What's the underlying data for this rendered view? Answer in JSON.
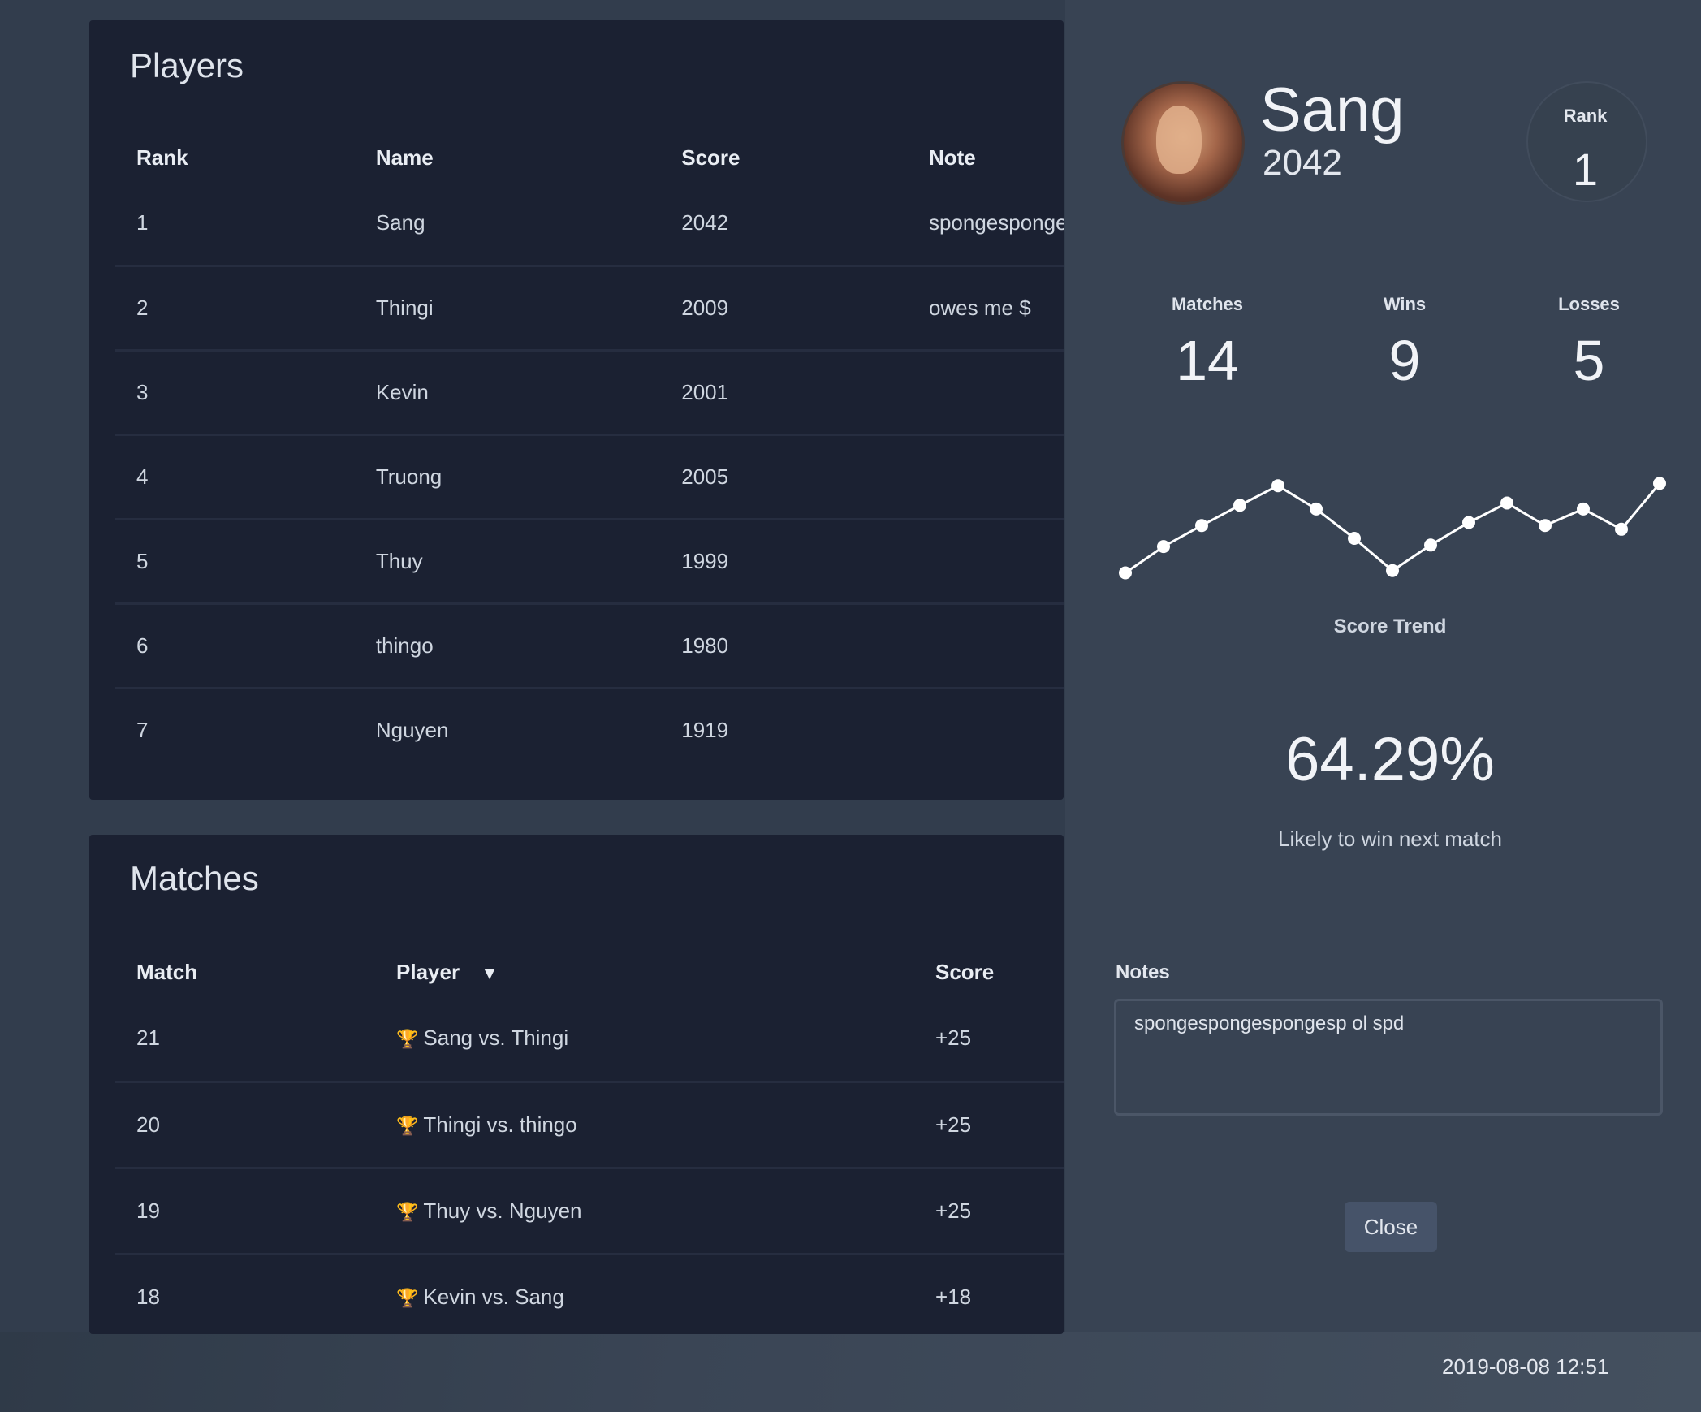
{
  "players": {
    "title": "Players",
    "columns": [
      "Rank",
      "Name",
      "Score",
      "Note"
    ],
    "rows": [
      {
        "rank": "1",
        "name": "Sang",
        "score": "2042",
        "note": "spongespongesp"
      },
      {
        "rank": "2",
        "name": "Thingi",
        "score": "2009",
        "note": "owes me $"
      },
      {
        "rank": "3",
        "name": "Kevin",
        "score": "2001",
        "note": ""
      },
      {
        "rank": "4",
        "name": "Truong",
        "score": "2005",
        "note": ""
      },
      {
        "rank": "5",
        "name": "Thuy",
        "score": "1999",
        "note": ""
      },
      {
        "rank": "6",
        "name": "thingo",
        "score": "1980",
        "note": ""
      },
      {
        "rank": "7",
        "name": "Nguyen",
        "score": "1919",
        "note": ""
      }
    ]
  },
  "matches": {
    "title": "Matches",
    "columns": [
      "Match",
      "Player",
      "Score"
    ],
    "sort_icon": "filter-triangle-icon",
    "rows": [
      {
        "match": "21",
        "players": "Sang vs. Thingi",
        "score": "+25"
      },
      {
        "match": "20",
        "players": "Thingi vs. thingo",
        "score": "+25"
      },
      {
        "match": "19",
        "players": "Thuy vs. Nguyen",
        "score": "+25"
      },
      {
        "match": "18",
        "players": "Kevin vs. Sang",
        "score": "+18"
      }
    ]
  },
  "detail": {
    "avatar": "player-avatar-photo",
    "name": "Sang",
    "score": "2042",
    "rank_label": "Rank",
    "rank_value": "1",
    "stats": [
      {
        "label": "Matches",
        "value": "14"
      },
      {
        "label": "Wins",
        "value": "9"
      },
      {
        "label": "Losses",
        "value": "5"
      }
    ],
    "trend_label": "Score Trend",
    "win_probability": "64.29%",
    "win_probability_label": "Likely to win next match",
    "notes_label": "Notes",
    "notes_value": "spongespongespongesp ol spd",
    "close_label": "Close"
  },
  "timestamp": "2019-08-08 12:51",
  "chart_data": {
    "type": "line",
    "title": "",
    "xlabel": "Score Trend",
    "ylabel": "",
    "x": [
      1,
      2,
      3,
      4,
      5,
      6,
      7,
      8,
      9,
      10,
      11,
      12,
      13,
      14,
      15
    ],
    "values": [
      1900,
      1935,
      1963,
      1990,
      2016,
      1985,
      1946,
      1903,
      1937,
      1967,
      1993,
      1963,
      1985,
      1958,
      2019
    ],
    "ylim": [
      1880,
      2040
    ],
    "grid": false,
    "line_color": "#ffffff"
  },
  "colors": {
    "page_bg": "#323d4d",
    "card_bg": "#1b2132",
    "panel_bg": "#384353",
    "button_bg": "#465369"
  }
}
